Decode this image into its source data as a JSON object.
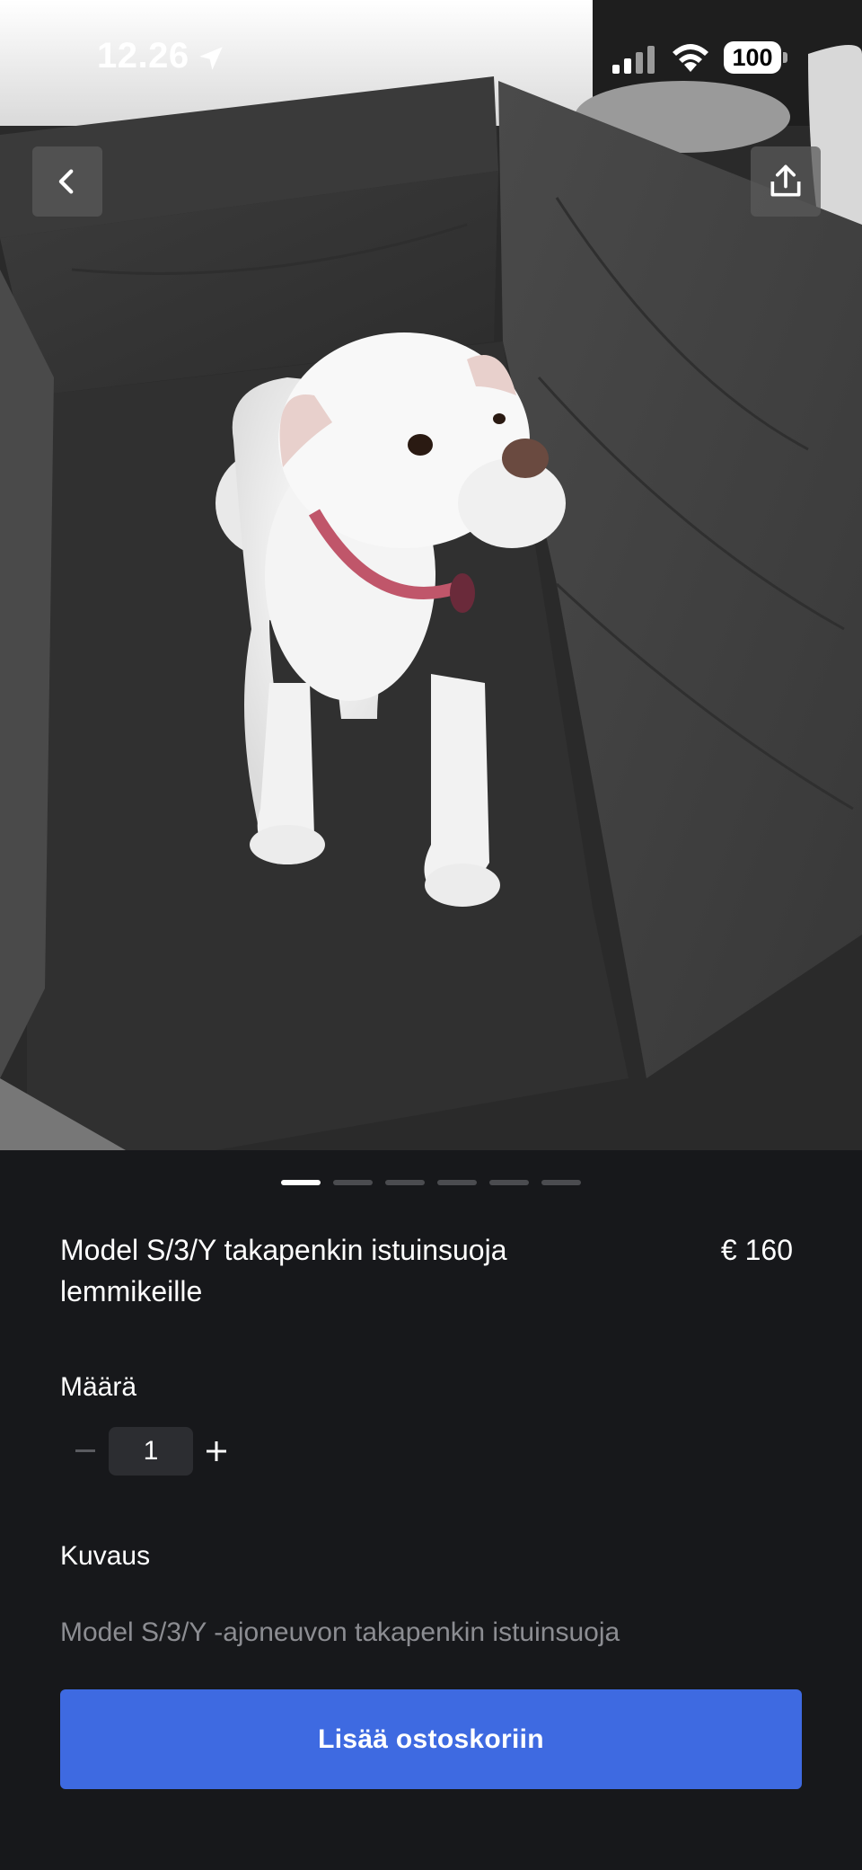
{
  "status_bar": {
    "time": "12.26",
    "battery": "100"
  },
  "gallery": {
    "total_images": 6,
    "active_index": 0
  },
  "product": {
    "title": "Model S/3/Y takapenkin istuinsuoja lemmikeille",
    "price": "€ 160"
  },
  "quantity": {
    "label": "Määrä",
    "value": "1",
    "decrement_symbol": "−",
    "increment_symbol": "+"
  },
  "description": {
    "label": "Kuvaus",
    "text": "Model S/3/Y -ajoneuvon takapenkin istuinsuoja"
  },
  "cta": {
    "label": "Lisää ostoskoriin",
    "color": "#3e6ae1"
  },
  "icons": {
    "back": "chevron-left-icon",
    "share": "share-icon",
    "location": "location-arrow-icon",
    "signal": "cellular-signal-icon",
    "wifi": "wifi-icon"
  }
}
